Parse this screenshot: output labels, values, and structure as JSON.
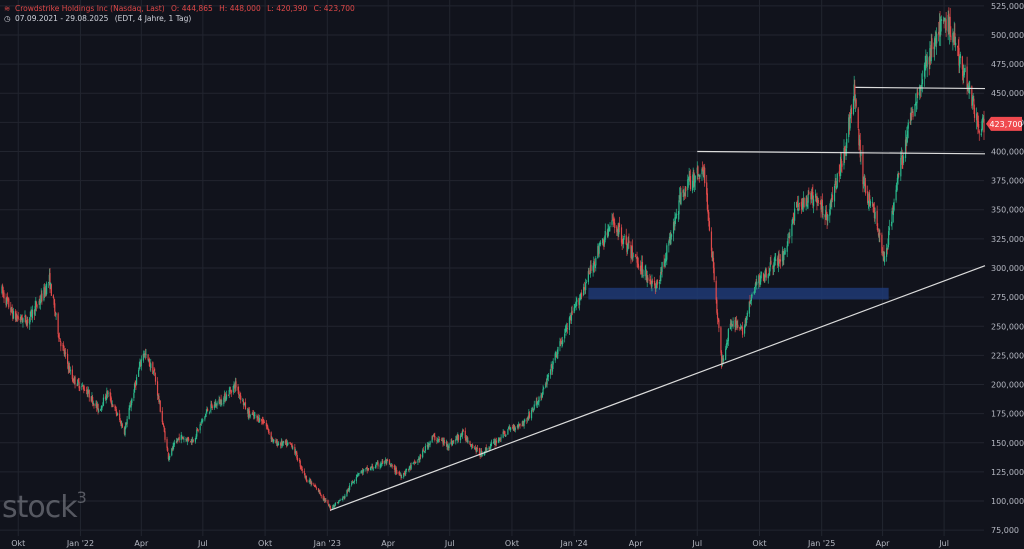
{
  "header": {
    "instrument": "Crowdstrike Holdings Inc (Nasdaq, Last)",
    "open_label": "O:",
    "open": "444,865",
    "high_label": "H:",
    "high": "448,000",
    "low_label": "L:",
    "low": "420,390",
    "close_label": "C:",
    "close": "423,700",
    "range": "07.09.2021 - 29.08.2025",
    "info": "(EDT, 4 Jahre, 1 Tag)"
  },
  "watermark": {
    "text": "stock",
    "sup": "3"
  },
  "colors": {
    "background": "#11131c",
    "grid": "#22252f",
    "up": "#2bb88c",
    "down": "#e04a4a",
    "price_badge": "#f04a4f",
    "lines": "#dcdcdc",
    "zone": "#1e3a74",
    "axis_text": "#b5b8c2"
  },
  "chart_data": {
    "type": "candlestick",
    "title": "",
    "x_range": [
      "2021-09-07",
      "2025-08-29"
    ],
    "x_tick_labels": [
      {
        "date": "2021-10-01",
        "label": "Okt"
      },
      {
        "date": "2022-01-01",
        "label": "Jan '22"
      },
      {
        "date": "2022-04-01",
        "label": "Apr"
      },
      {
        "date": "2022-07-01",
        "label": "Jul"
      },
      {
        "date": "2022-10-01",
        "label": "Okt"
      },
      {
        "date": "2023-01-01",
        "label": "Jan '23"
      },
      {
        "date": "2023-04-01",
        "label": "Apr"
      },
      {
        "date": "2023-07-01",
        "label": "Jul"
      },
      {
        "date": "2023-10-01",
        "label": "Okt"
      },
      {
        "date": "2024-01-01",
        "label": "Jan '24"
      },
      {
        "date": "2024-04-01",
        "label": "Apr"
      },
      {
        "date": "2024-07-01",
        "label": "Jul"
      },
      {
        "date": "2024-10-01",
        "label": "Okt"
      },
      {
        "date": "2025-01-01",
        "label": "Jan '25"
      },
      {
        "date": "2025-04-01",
        "label": "Apr"
      },
      {
        "date": "2025-07-01",
        "label": "Jul"
      }
    ],
    "ylim": [
      70000,
      530000
    ],
    "y_ticks": [
      75000,
      100000,
      125000,
      150000,
      175000,
      200000,
      225000,
      250000,
      275000,
      300000,
      325000,
      350000,
      375000,
      400000,
      425000,
      450000,
      475000,
      500000,
      525000
    ],
    "y_tick_labels": [
      "75,000",
      "100,000",
      "125,000",
      "150,000",
      "175,000",
      "200,000",
      "225,000",
      "250,000",
      "275,000",
      "300,000",
      "325,000",
      "350,000",
      "375,000",
      "400,000",
      "425,000",
      "450,000",
      "475,000",
      "500,000",
      "525,000"
    ],
    "grid": true,
    "last_price": 423700,
    "last_price_label": "423,700",
    "price_path": [
      {
        "date": "2021-09-07",
        "value": 280000
      },
      {
        "date": "2021-09-25",
        "value": 258000
      },
      {
        "date": "2021-10-15",
        "value": 255000
      },
      {
        "date": "2021-11-05",
        "value": 275000
      },
      {
        "date": "2021-11-16",
        "value": 290000
      },
      {
        "date": "2021-12-01",
        "value": 240000
      },
      {
        "date": "2021-12-20",
        "value": 205000
      },
      {
        "date": "2022-01-10",
        "value": 195000
      },
      {
        "date": "2022-01-28",
        "value": 178000
      },
      {
        "date": "2022-02-10",
        "value": 193000
      },
      {
        "date": "2022-03-07",
        "value": 160000
      },
      {
        "date": "2022-03-25",
        "value": 205000
      },
      {
        "date": "2022-04-04",
        "value": 228000
      },
      {
        "date": "2022-04-20",
        "value": 210000
      },
      {
        "date": "2022-05-11",
        "value": 138000
      },
      {
        "date": "2022-05-27",
        "value": 155000
      },
      {
        "date": "2022-06-16",
        "value": 152000
      },
      {
        "date": "2022-07-08",
        "value": 178000
      },
      {
        "date": "2022-08-01",
        "value": 188000
      },
      {
        "date": "2022-08-18",
        "value": 200000
      },
      {
        "date": "2022-09-06",
        "value": 175000
      },
      {
        "date": "2022-09-30",
        "value": 168000
      },
      {
        "date": "2022-10-14",
        "value": 150000
      },
      {
        "date": "2022-11-10",
        "value": 148000
      },
      {
        "date": "2022-11-30",
        "value": 120000
      },
      {
        "date": "2022-12-20",
        "value": 108000
      },
      {
        "date": "2023-01-05",
        "value": 94000
      },
      {
        "date": "2023-01-25",
        "value": 103000
      },
      {
        "date": "2023-02-15",
        "value": 124000
      },
      {
        "date": "2023-03-06",
        "value": 128000
      },
      {
        "date": "2023-03-28",
        "value": 134000
      },
      {
        "date": "2023-04-20",
        "value": 122000
      },
      {
        "date": "2023-05-15",
        "value": 135000
      },
      {
        "date": "2023-06-06",
        "value": 155000
      },
      {
        "date": "2023-06-30",
        "value": 148000
      },
      {
        "date": "2023-07-20",
        "value": 158000
      },
      {
        "date": "2023-08-15",
        "value": 140000
      },
      {
        "date": "2023-09-05",
        "value": 150000
      },
      {
        "date": "2023-09-28",
        "value": 162000
      },
      {
        "date": "2023-10-20",
        "value": 168000
      },
      {
        "date": "2023-11-15",
        "value": 192000
      },
      {
        "date": "2023-12-05",
        "value": 225000
      },
      {
        "date": "2023-12-28",
        "value": 258000
      },
      {
        "date": "2024-01-20",
        "value": 290000
      },
      {
        "date": "2024-02-08",
        "value": 318000
      },
      {
        "date": "2024-02-28",
        "value": 340000
      },
      {
        "date": "2024-03-20",
        "value": 318000
      },
      {
        "date": "2024-04-15",
        "value": 296000
      },
      {
        "date": "2024-05-01",
        "value": 282000
      },
      {
        "date": "2024-05-20",
        "value": 320000
      },
      {
        "date": "2024-06-10",
        "value": 368000
      },
      {
        "date": "2024-06-28",
        "value": 378000
      },
      {
        "date": "2024-07-10",
        "value": 385000
      },
      {
        "date": "2024-07-22",
        "value": 320000
      },
      {
        "date": "2024-08-06",
        "value": 218000
      },
      {
        "date": "2024-08-20",
        "value": 255000
      },
      {
        "date": "2024-09-05",
        "value": 245000
      },
      {
        "date": "2024-09-25",
        "value": 285000
      },
      {
        "date": "2024-10-15",
        "value": 300000
      },
      {
        "date": "2024-11-05",
        "value": 310000
      },
      {
        "date": "2024-11-25",
        "value": 352000
      },
      {
        "date": "2024-12-20",
        "value": 360000
      },
      {
        "date": "2025-01-10",
        "value": 345000
      },
      {
        "date": "2025-02-05",
        "value": 405000
      },
      {
        "date": "2025-02-18",
        "value": 450000
      },
      {
        "date": "2025-03-04",
        "value": 370000
      },
      {
        "date": "2025-03-20",
        "value": 348000
      },
      {
        "date": "2025-04-04",
        "value": 305000
      },
      {
        "date": "2025-04-22",
        "value": 372000
      },
      {
        "date": "2025-05-15",
        "value": 435000
      },
      {
        "date": "2025-06-06",
        "value": 478000
      },
      {
        "date": "2025-06-25",
        "value": 505000
      },
      {
        "date": "2025-07-08",
        "value": 510000
      },
      {
        "date": "2025-07-25",
        "value": 478000
      },
      {
        "date": "2025-08-08",
        "value": 455000
      },
      {
        "date": "2025-08-20",
        "value": 420000
      },
      {
        "date": "2025-08-29",
        "value": 423700
      }
    ],
    "annotations": [
      {
        "type": "trendline",
        "from": {
          "date": "2023-01-05",
          "value": 92000
        },
        "to": {
          "date": "2025-08-29",
          "value": 302000
        }
      },
      {
        "type": "horizontal",
        "from": {
          "date": "2024-07-01",
          "value": 400000
        },
        "to": {
          "date": "2025-08-29",
          "value": 398000
        }
      },
      {
        "type": "horizontal",
        "from": {
          "date": "2025-02-20",
          "value": 455000
        },
        "to": {
          "date": "2025-08-29",
          "value": 454000
        }
      },
      {
        "type": "zone",
        "from": {
          "date": "2024-01-22",
          "value": 283000
        },
        "to": {
          "date": "2025-04-10",
          "value": 273000
        }
      }
    ]
  }
}
